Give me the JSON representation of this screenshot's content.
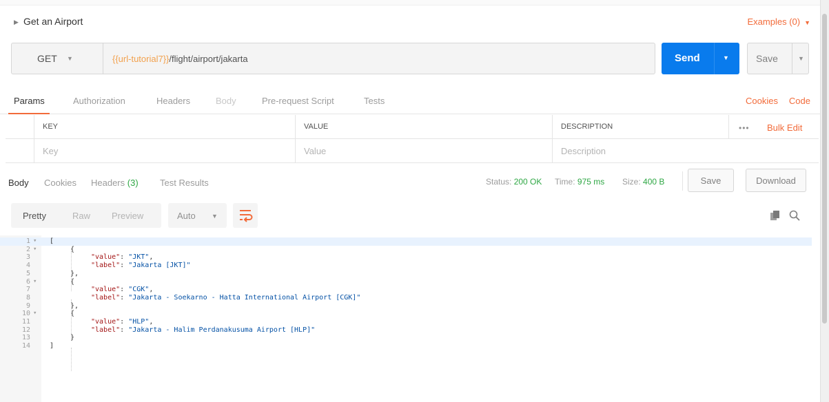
{
  "request": {
    "name": "Get an Airport",
    "examples_label": "Examples (0)",
    "method": "GET",
    "url_variable": "{{url-tutorial7}}",
    "url_path": "/flight/airport/jakarta",
    "send_label": "Send",
    "save_label": "Save"
  },
  "request_tabs": {
    "items": [
      "Params",
      "Authorization",
      "Headers",
      "Body",
      "Pre-request Script",
      "Tests"
    ],
    "active": "Params",
    "cookies_link": "Cookies",
    "code_link": "Code"
  },
  "params_table": {
    "headers": [
      "KEY",
      "VALUE",
      "DESCRIPTION"
    ],
    "placeholders": [
      "Key",
      "Value",
      "Description"
    ],
    "more_label": "•••",
    "bulk_edit_label": "Bulk Edit"
  },
  "response": {
    "tabs": {
      "body": "Body",
      "cookies": "Cookies",
      "headers": "Headers",
      "headers_count": "(3)",
      "test_results": "Test Results"
    },
    "status_label": "Status:",
    "status_value": "200 OK",
    "time_label": "Time:",
    "time_value": "975 ms",
    "size_label": "Size:",
    "size_value": "400 B",
    "save_label": "Save",
    "download_label": "Download",
    "format_options": [
      "Pretty",
      "Raw",
      "Preview"
    ],
    "format_active": "Pretty",
    "language": "Auto"
  },
  "body_lines": [
    {
      "n": "1",
      "fold": true,
      "text": "["
    },
    {
      "n": "2",
      "fold": true,
      "text": "{"
    },
    {
      "n": "3",
      "key": "\"value\"",
      "val": "\"JKT\"",
      "trail": ","
    },
    {
      "n": "4",
      "key": "\"label\"",
      "val": "\"Jakarta [JKT]\"",
      "trail": ""
    },
    {
      "n": "5",
      "text": "},"
    },
    {
      "n": "6",
      "fold": true,
      "text": "{"
    },
    {
      "n": "7",
      "key": "\"value\"",
      "val": "\"CGK\"",
      "trail": ","
    },
    {
      "n": "8",
      "key": "\"label\"",
      "val": "\"Jakarta - Soekarno - Hatta International Airport [CGK]\"",
      "trail": ""
    },
    {
      "n": "9",
      "text": "},"
    },
    {
      "n": "10",
      "fold": true,
      "text": "{"
    },
    {
      "n": "11",
      "key": "\"value\"",
      "val": "\"HLP\"",
      "trail": ","
    },
    {
      "n": "12",
      "key": "\"label\"",
      "val": "\"Jakarta - Halim Perdanakusuma Airport [HLP]\"",
      "trail": ""
    },
    {
      "n": "13",
      "text": "}"
    },
    {
      "n": "14",
      "text": "]"
    }
  ],
  "colors": {
    "accent": "#f26b3a",
    "send": "#097bed",
    "success": "#2ea744",
    "json_key": "#a31515",
    "json_string": "#0451a5"
  }
}
